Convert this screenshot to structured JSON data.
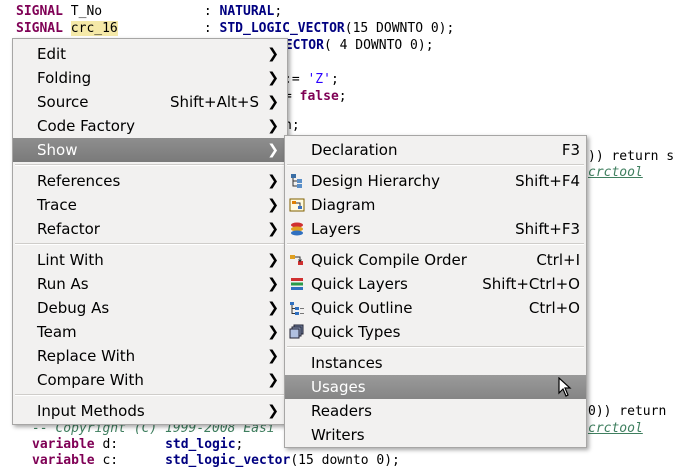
{
  "code": {
    "line1": {
      "kw": "SIGNAL",
      "name": "T_No",
      "colon": ": ",
      "type": "NATURAL",
      ";": ";"
    },
    "line2": {
      "kw": "SIGNAL",
      "name": "crc_16",
      "colon": ": ",
      "type": "STD_LOGIC_VECTOR",
      "args": "(15 DOWNTO 0);"
    },
    "line3": {
      "type": "VECTOR",
      "args": "( 4 DOWNTO 0);"
    },
    "line4": {
      "op": ":=",
      "str": "'Z'",
      ";": ";"
    },
    "line5": {
      "op": "=",
      "kw": "false",
      ";": ";"
    },
    "line6": {
      "text": "n;"
    },
    "line7": {
      "text": ")) return st"
    },
    "line8": {
      "link": "crctool"
    },
    "line9": {
      "text": "0)) return"
    },
    "line10": {
      "cm": "-- Copyright (C) 1999-2008 Easi",
      "link": "crctool"
    },
    "line11": {
      "kw": "variable",
      "name": "d:",
      "type": "std_logic",
      ";": ";"
    },
    "line12": {
      "kw": "variable",
      "name": "c:",
      "type": "std_logic_vector",
      "args": "(15 downto 0);"
    }
  },
  "context_menu": {
    "items": [
      {
        "label": "Edit",
        "shortcut": "",
        "submenu": true
      },
      {
        "label": "Folding",
        "shortcut": "",
        "submenu": true
      },
      {
        "label": "Source",
        "shortcut": "Shift+Alt+S",
        "submenu": true
      },
      {
        "label": "Code Factory",
        "shortcut": "",
        "submenu": true
      },
      {
        "label": "Show",
        "shortcut": "",
        "submenu": true,
        "selected": true
      },
      {
        "label": "References",
        "shortcut": "",
        "submenu": true
      },
      {
        "label": "Trace",
        "shortcut": "",
        "submenu": true
      },
      {
        "label": "Refactor",
        "shortcut": "",
        "submenu": true
      },
      {
        "label": "Lint With",
        "shortcut": "",
        "submenu": true
      },
      {
        "label": "Run As",
        "shortcut": "",
        "submenu": true
      },
      {
        "label": "Debug As",
        "shortcut": "",
        "submenu": true
      },
      {
        "label": "Team",
        "shortcut": "",
        "submenu": true
      },
      {
        "label": "Replace With",
        "shortcut": "",
        "submenu": true
      },
      {
        "label": "Compare With",
        "shortcut": "",
        "submenu": true
      },
      {
        "label": "Input Methods",
        "shortcut": "",
        "submenu": true
      }
    ]
  },
  "show_submenu": {
    "items": [
      {
        "label": "Declaration",
        "shortcut": "F3",
        "icon": ""
      },
      {
        "label": "Design Hierarchy",
        "shortcut": "Shift+F4",
        "icon": "hierarchy-icon"
      },
      {
        "label": "Diagram",
        "shortcut": "",
        "icon": "diagram-icon"
      },
      {
        "label": "Layers",
        "shortcut": "Shift+F3",
        "icon": "layers-icon"
      },
      {
        "label": "Quick Compile Order",
        "shortcut": "Ctrl+I",
        "icon": "compile-order-icon"
      },
      {
        "label": "Quick Layers",
        "shortcut": "Shift+Ctrl+O",
        "icon": "quick-layers-icon"
      },
      {
        "label": "Quick Outline",
        "shortcut": "Ctrl+O",
        "icon": "outline-icon"
      },
      {
        "label": "Quick Types",
        "shortcut": "",
        "icon": "types-icon"
      },
      {
        "label": "Instances",
        "shortcut": "",
        "icon": ""
      },
      {
        "label": "Usages",
        "shortcut": "",
        "icon": "",
        "selected": true
      },
      {
        "label": "Readers",
        "shortcut": "",
        "icon": ""
      },
      {
        "label": "Writers",
        "shortcut": "",
        "icon": ""
      }
    ]
  },
  "glyphs": {
    "arrow": "❯"
  }
}
